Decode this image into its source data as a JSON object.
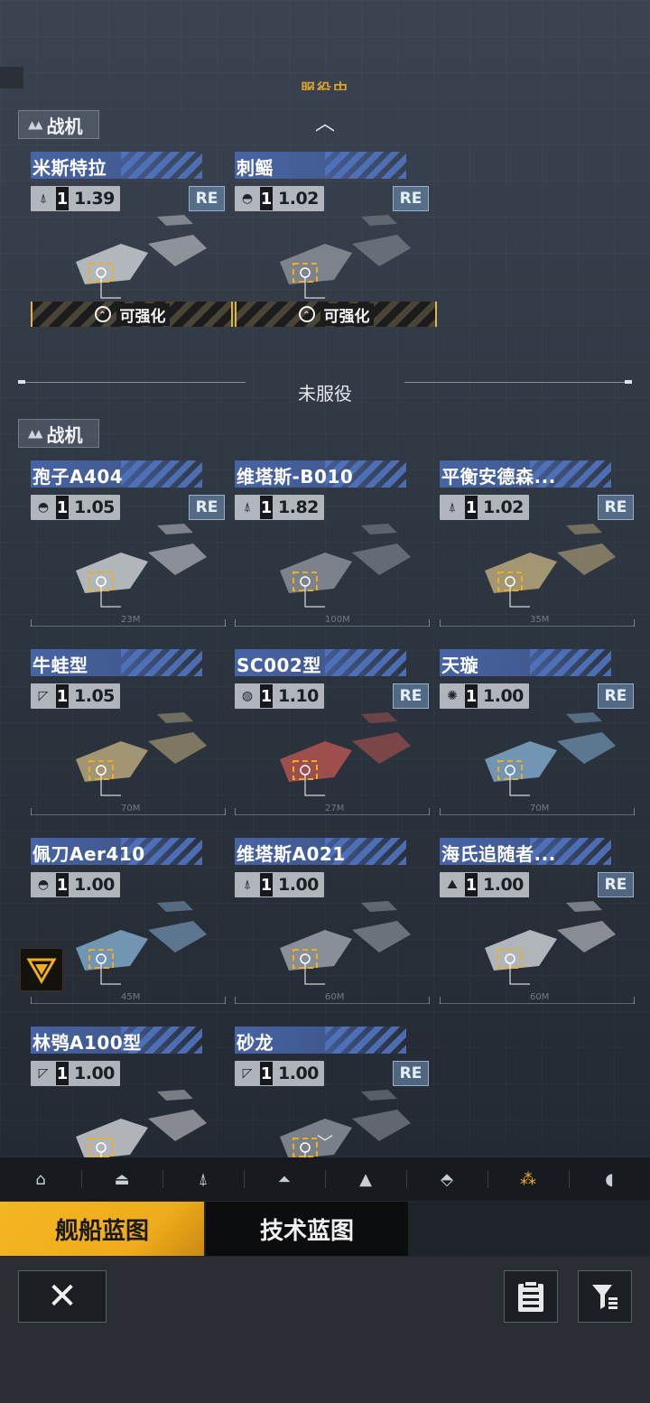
{
  "top_status": "服役中",
  "in_service": {
    "category": "战机",
    "ships": [
      {
        "name": "米斯特拉",
        "class_icon": "fighter-icon",
        "level": "1",
        "value": "1.39",
        "re": "RE",
        "upgrade": "可强化"
      },
      {
        "name": "刺鳐",
        "class_icon": "ship-class-icon",
        "level": "1",
        "value": "1.02",
        "re": "RE",
        "upgrade": "可强化"
      }
    ]
  },
  "divider_label": "未服役",
  "not_in_service": {
    "category": "战机",
    "ships": [
      {
        "name": "孢子A404",
        "class_icon": "ship-class-icon",
        "level": "1",
        "value": "1.05",
        "re": "RE",
        "size": "23M"
      },
      {
        "name": "维塔斯-B010",
        "class_icon": "fighter-icon",
        "level": "1",
        "value": "1.82",
        "re": "",
        "size": "100M"
      },
      {
        "name": "平衡安德森...",
        "class_icon": "fighter-icon",
        "level": "1",
        "value": "1.02",
        "re": "RE",
        "size": "35M"
      },
      {
        "name": "牛蛙型",
        "class_icon": "maker-icon",
        "level": "1",
        "value": "1.05",
        "re": "",
        "size": "70M"
      },
      {
        "name": "SC002型",
        "class_icon": "globe-icon",
        "level": "1",
        "value": "1.10",
        "re": "RE",
        "size": "27M"
      },
      {
        "name": "天璇",
        "class_icon": "swirl-icon",
        "level": "1",
        "value": "1.00",
        "re": "RE",
        "size": "70M"
      },
      {
        "name": "佩刀Aer410",
        "class_icon": "ship-class-icon",
        "level": "1",
        "value": "1.00",
        "re": "",
        "size": "45M"
      },
      {
        "name": "维塔斯A021",
        "class_icon": "fighter-icon",
        "level": "1",
        "value": "1.00",
        "re": "",
        "size": "60M"
      },
      {
        "name": "海氏追随者...",
        "class_icon": "mountain-icon",
        "level": "1",
        "value": "1.00",
        "re": "RE",
        "size": "60M"
      },
      {
        "name": "林鸮A100型",
        "class_icon": "maker-icon",
        "level": "1",
        "value": "1.00",
        "re": "",
        "size": ""
      },
      {
        "name": "砂龙",
        "class_icon": "maker-icon",
        "level": "1",
        "value": "1.00",
        "re": "RE",
        "size": ""
      }
    ]
  },
  "filters": [
    {
      "icon": "station-icon",
      "active": false
    },
    {
      "icon": "capital-ship-icon",
      "active": false
    },
    {
      "icon": "frigate-icon",
      "active": false
    },
    {
      "icon": "corvette-icon",
      "active": false
    },
    {
      "icon": "destroyer-icon",
      "active": false
    },
    {
      "icon": "carrier-icon",
      "active": false
    },
    {
      "icon": "fighter-group-icon",
      "active": true
    },
    {
      "icon": "dome-icon",
      "active": false
    }
  ],
  "tabs": {
    "ship_blueprint": "舰船蓝图",
    "tech_blueprint": "技术蓝图"
  },
  "colors": {
    "accent": "#f4b623",
    "name_bar": "#4866aa",
    "bg": "#2c343f"
  }
}
